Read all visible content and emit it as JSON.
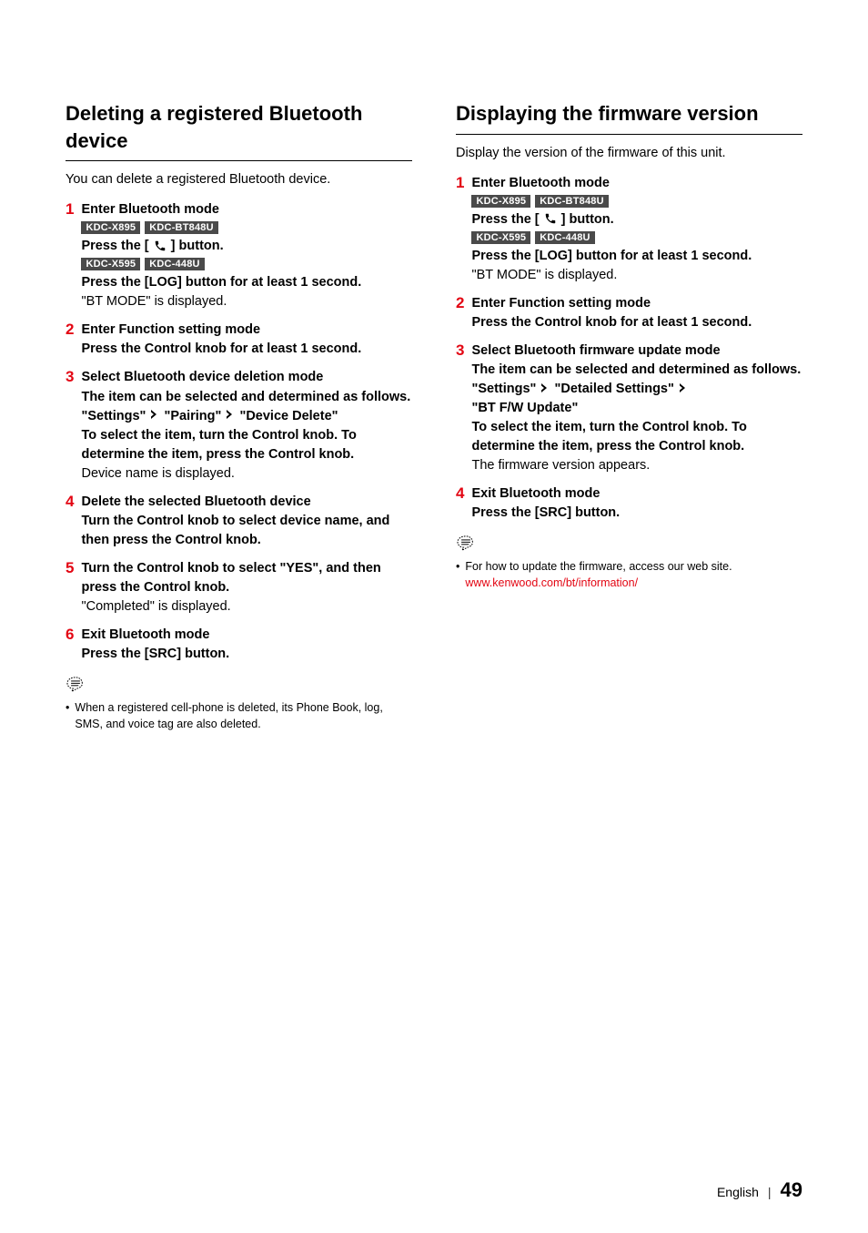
{
  "left": {
    "heading": "Deleting a registered Bluetooth device",
    "intro": "You can delete a registered Bluetooth device.",
    "steps": [
      {
        "num": "1",
        "title": "Enter Bluetooth mode",
        "badges1": [
          "KDC-X895",
          "KDC-BT848U"
        ],
        "press1_a": "Press the [ ",
        "press1_b": " ] button.",
        "badges2": [
          "KDC-X595",
          "KDC-448U"
        ],
        "press2": "Press the [LOG] button for at least 1 second.",
        "result": "\"BT MODE\" is displayed."
      },
      {
        "num": "2",
        "title": "Enter Function setting mode",
        "text": "Press the Control knob for at least 1 second."
      },
      {
        "num": "3",
        "title": "Select Bluetooth device deletion mode",
        "text1": "The item can be selected and determined as follows.",
        "path_a": "\"Settings\"",
        "path_b": "\"Pairing\"",
        "path_c": "\"Device Delete\"",
        "text2": "To select the item, turn the Control knob. To determine the item, press the Control knob.",
        "result": "Device name is displayed."
      },
      {
        "num": "4",
        "title": "Delete the selected Bluetooth device",
        "text": "Turn the Control knob to select device name, and then press the Control knob."
      },
      {
        "num": "5",
        "title": "Turn the Control knob to select \"YES\", and then press the Control knob.",
        "result": "\"Completed\" is displayed."
      },
      {
        "num": "6",
        "title": "Exit Bluetooth mode",
        "text": "Press the [SRC] button."
      }
    ],
    "note": "When a registered cell-phone is deleted, its Phone Book, log, SMS, and voice tag are also deleted."
  },
  "right": {
    "heading": "Displaying the firmware version",
    "intro": "Display the version of the firmware of this unit.",
    "steps": [
      {
        "num": "1",
        "title": "Enter Bluetooth mode",
        "badges1": [
          "KDC-X895",
          "KDC-BT848U"
        ],
        "press1_a": "Press the [ ",
        "press1_b": " ] button.",
        "badges2": [
          "KDC-X595",
          "KDC-448U"
        ],
        "press2": "Press the [LOG] button for at least 1 second.",
        "result": "\"BT MODE\" is displayed."
      },
      {
        "num": "2",
        "title": "Enter Function setting mode",
        "text": "Press the Control knob for at least 1 second."
      },
      {
        "num": "3",
        "title": "Select Bluetooth firmware update mode",
        "text1": "The item can be selected and determined as follows.",
        "path_a": "\"Settings\"",
        "path_b": "\"Detailed Settings\"",
        "path_c": "\"BT F/W Update\"",
        "text2": "To select the item, turn the Control knob. To determine the item, press the Control knob.",
        "result": "The firmware version appears."
      },
      {
        "num": "4",
        "title": "Exit Bluetooth mode",
        "text": "Press the [SRC] button."
      }
    ],
    "note_text": "For how to update the firmware, access our web site.",
    "note_link": "www.kenwood.com/bt/information/"
  },
  "footer": {
    "lang": "English",
    "sep": "|",
    "page": "49"
  }
}
